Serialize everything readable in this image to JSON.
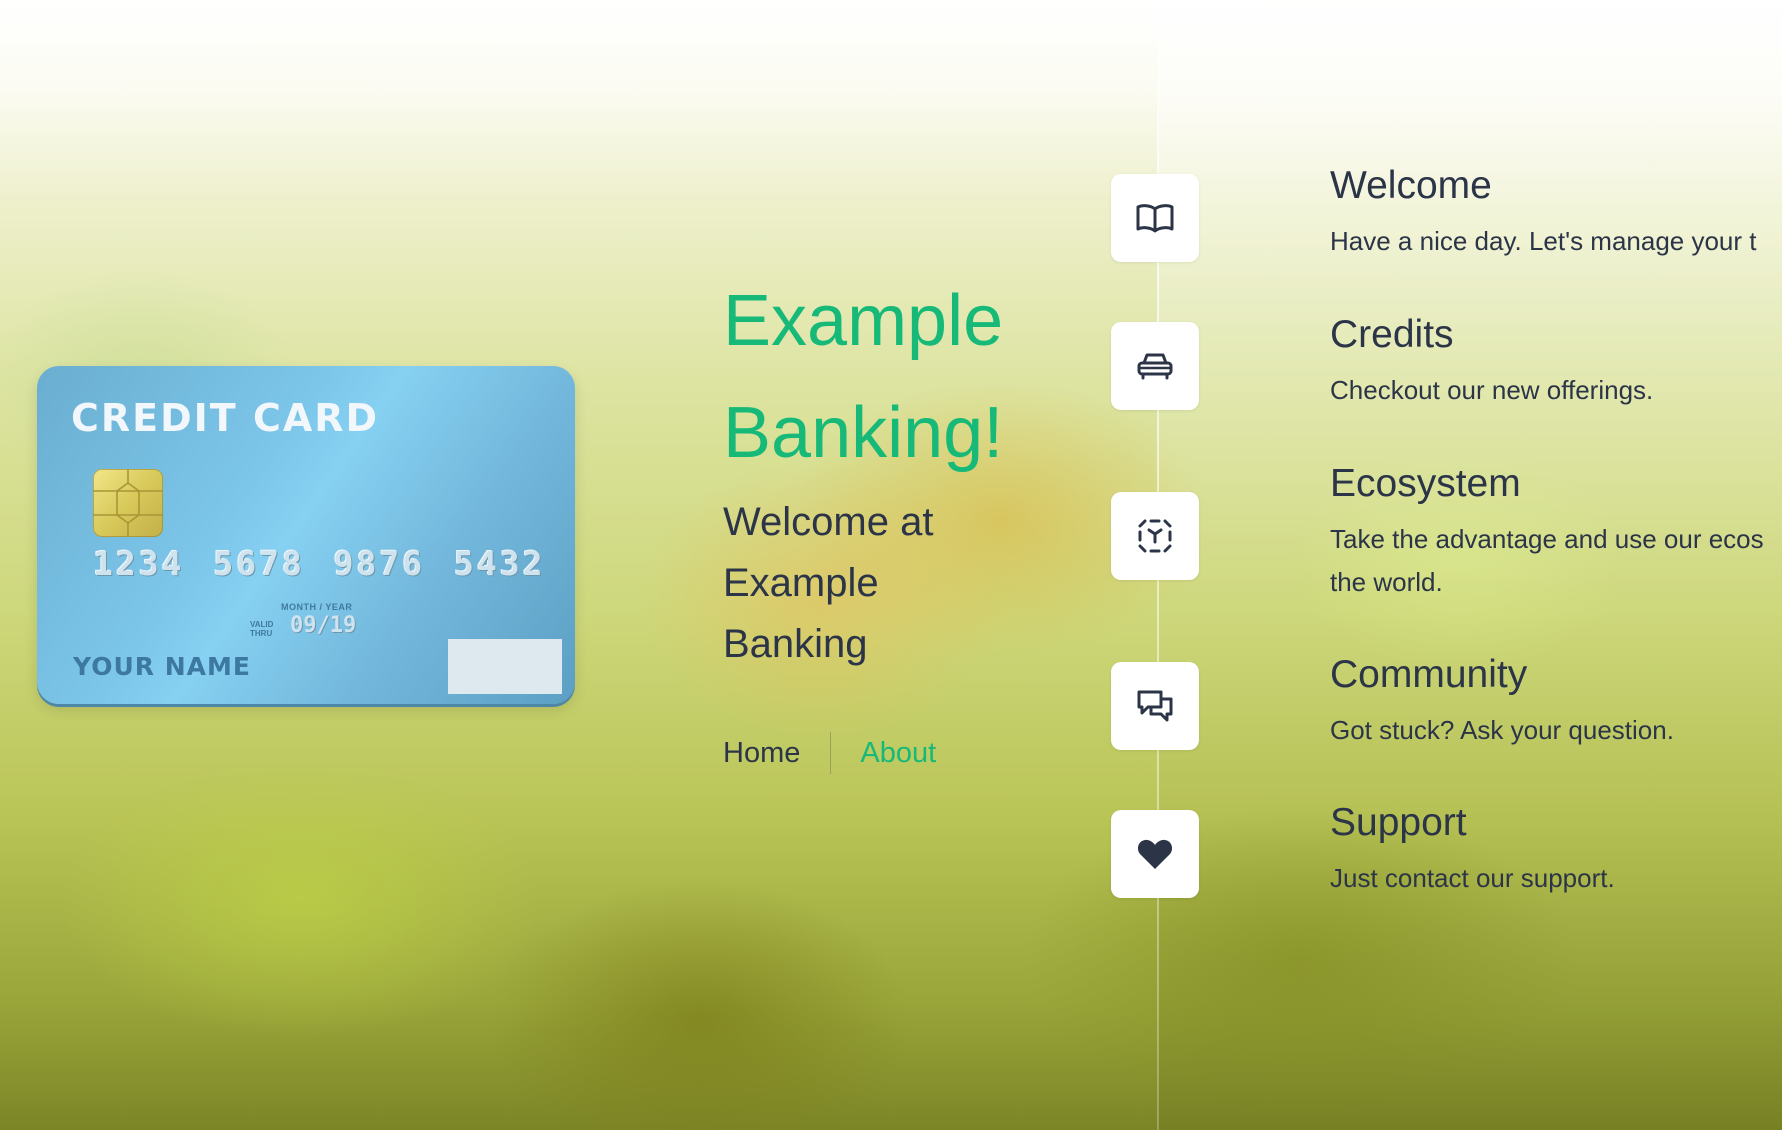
{
  "credit_card": {
    "title": "CREDIT CARD",
    "number": "1234 5678 9876 5432",
    "month_year_label": "MONTH / YEAR",
    "valid_thru_label": "VALID THRU",
    "expiry": "09/19",
    "name": "YOUR NAME"
  },
  "brand": {
    "line1": "Example",
    "line2": "Banking!"
  },
  "welcome": {
    "line1": "Welcome at",
    "line2": "Example",
    "line3": "Banking"
  },
  "nav": {
    "items": [
      {
        "label": "Home",
        "active": false
      },
      {
        "label": "About",
        "active": true
      }
    ]
  },
  "features": [
    {
      "title": "Welcome",
      "desc": "Have a nice day. Let's manage your t",
      "icon": "book-icon"
    },
    {
      "title": "Credits",
      "desc": "Checkout our new offerings.",
      "icon": "car-icon"
    },
    {
      "title": "Ecosystem",
      "desc": "Take the advantage and use our ecos the world.",
      "icon": "scan-icon"
    },
    {
      "title": "Community",
      "desc": "Got stuck? Ask your question.",
      "icon": "chat-icon"
    },
    {
      "title": "Support",
      "desc": "Just contact our support.",
      "icon": "heart-icon"
    }
  ],
  "colors": {
    "accent": "#17b978",
    "text": "#2b3547",
    "card": "#7cc6ea"
  }
}
